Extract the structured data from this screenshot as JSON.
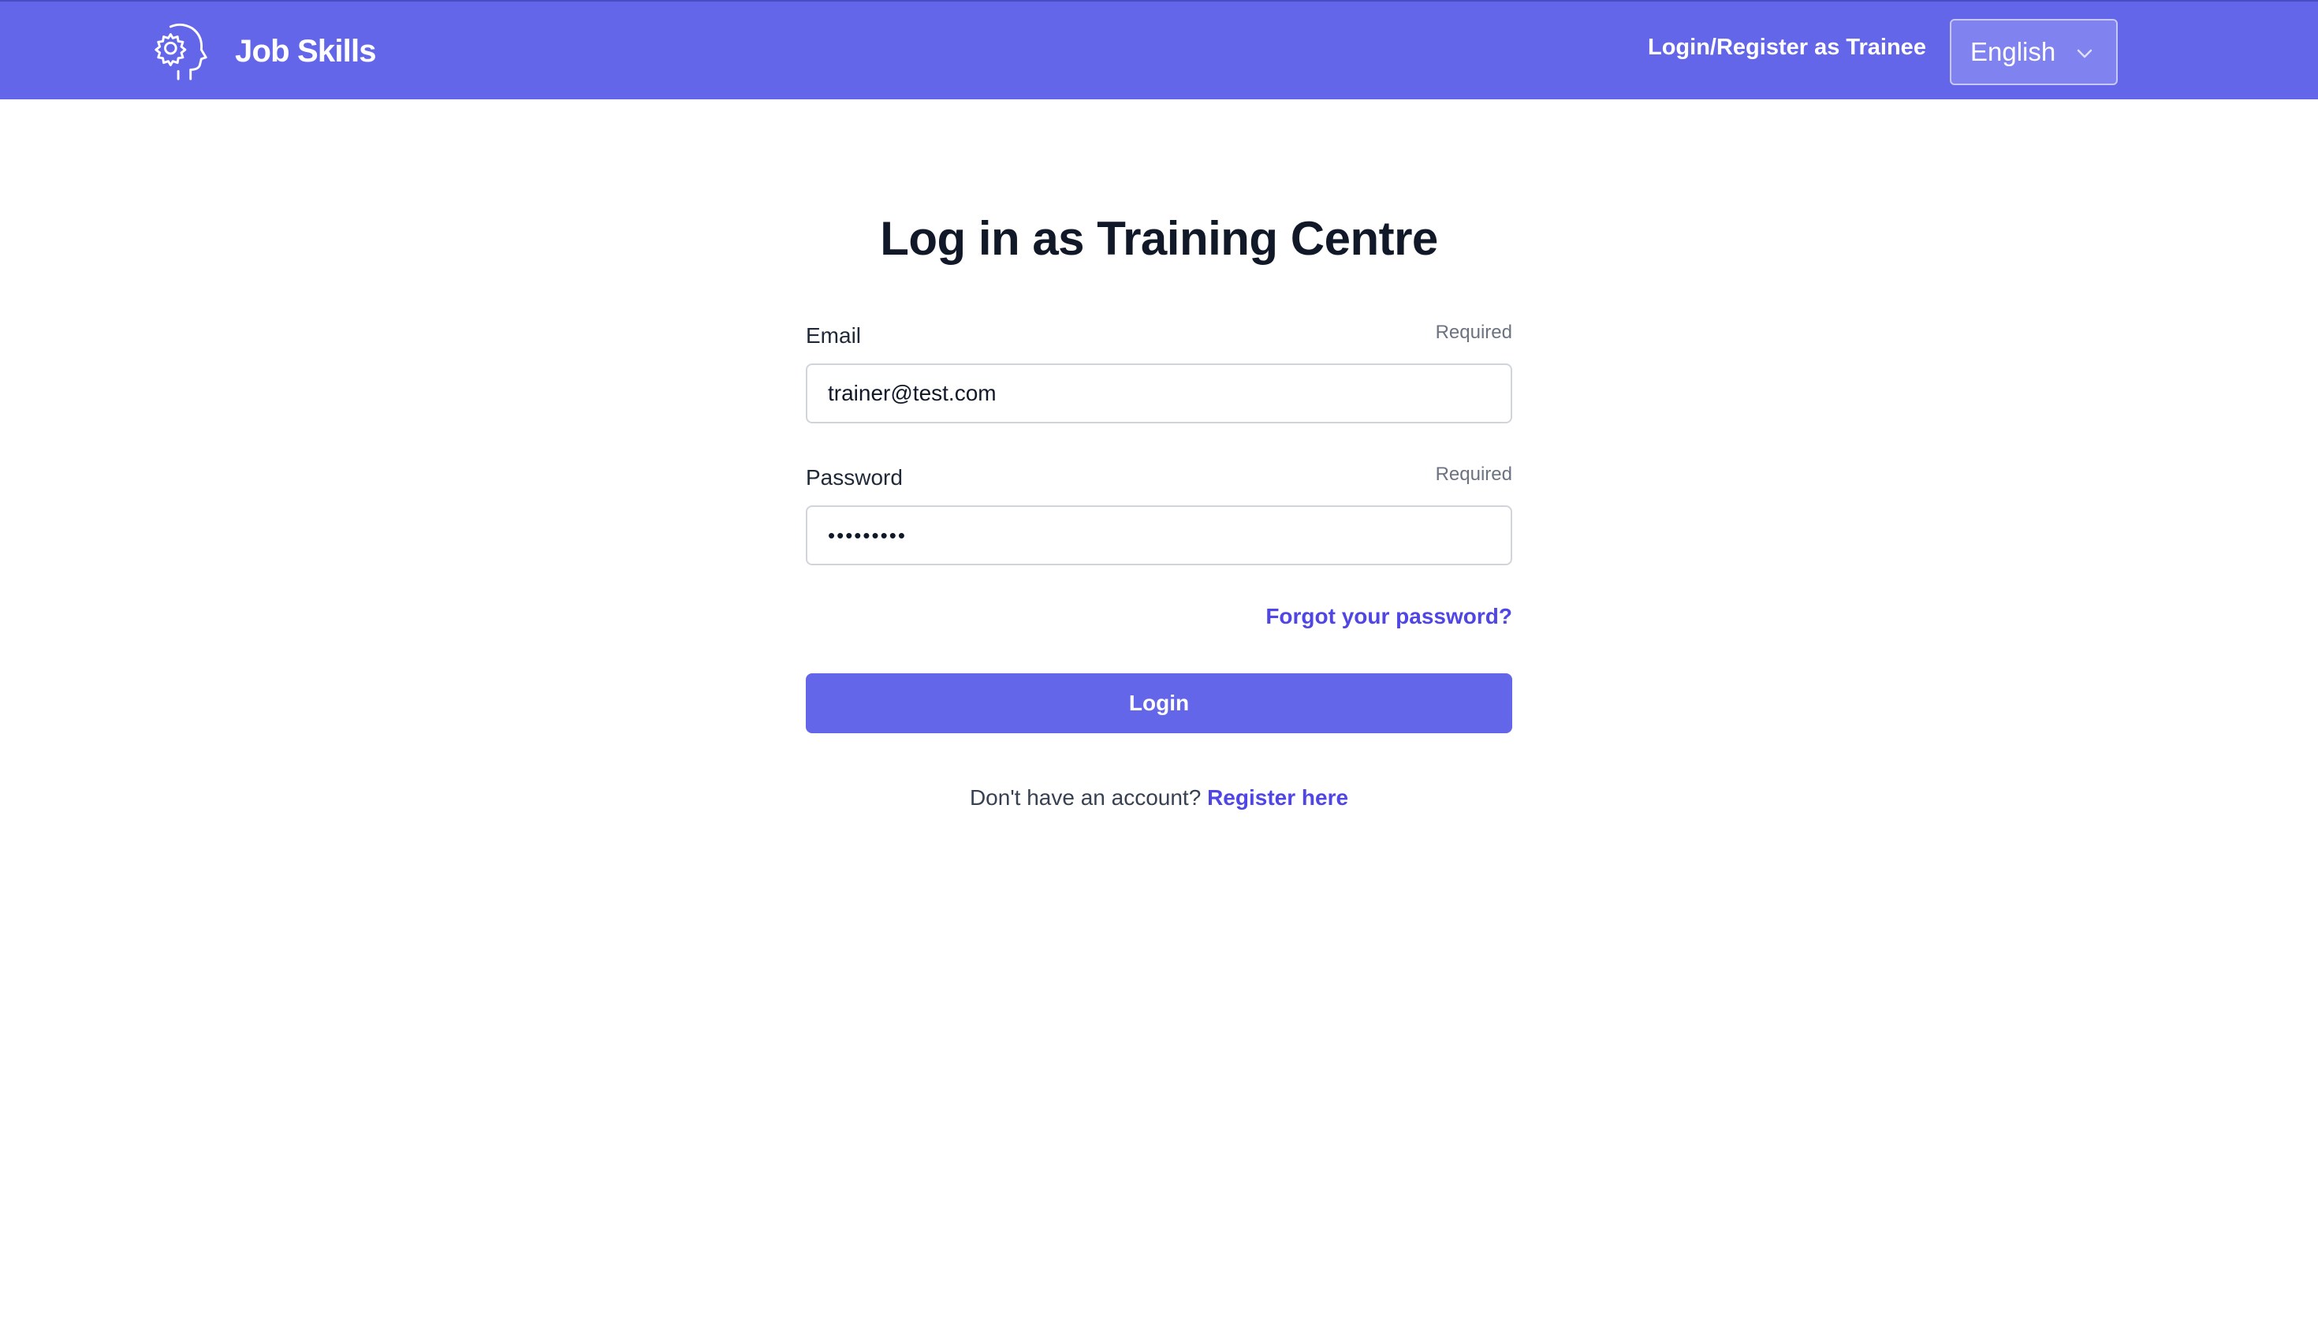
{
  "header": {
    "brand_name": "Job Skills",
    "brand_icon": "gear-head-icon",
    "nav_link": "Login/Register as Trainee",
    "language": {
      "selected": "English",
      "icon": "chevron-down-icon"
    },
    "colors": {
      "bar": "#6366e9",
      "text": "#ffffff"
    }
  },
  "main": {
    "title": "Log in as Training Centre",
    "email": {
      "label": "Email",
      "required_text": "Required",
      "value": "trainer@test.com"
    },
    "password": {
      "label": "Password",
      "required_text": "Required",
      "value": "•••••••••"
    },
    "forgot_password": "Forgot your password?",
    "login_button": "Login",
    "register_prompt": "Don't have an account?",
    "register_link": "Register here",
    "colors": {
      "primary": "#6366e9",
      "link": "#4f46e5",
      "title": "#111827"
    }
  }
}
